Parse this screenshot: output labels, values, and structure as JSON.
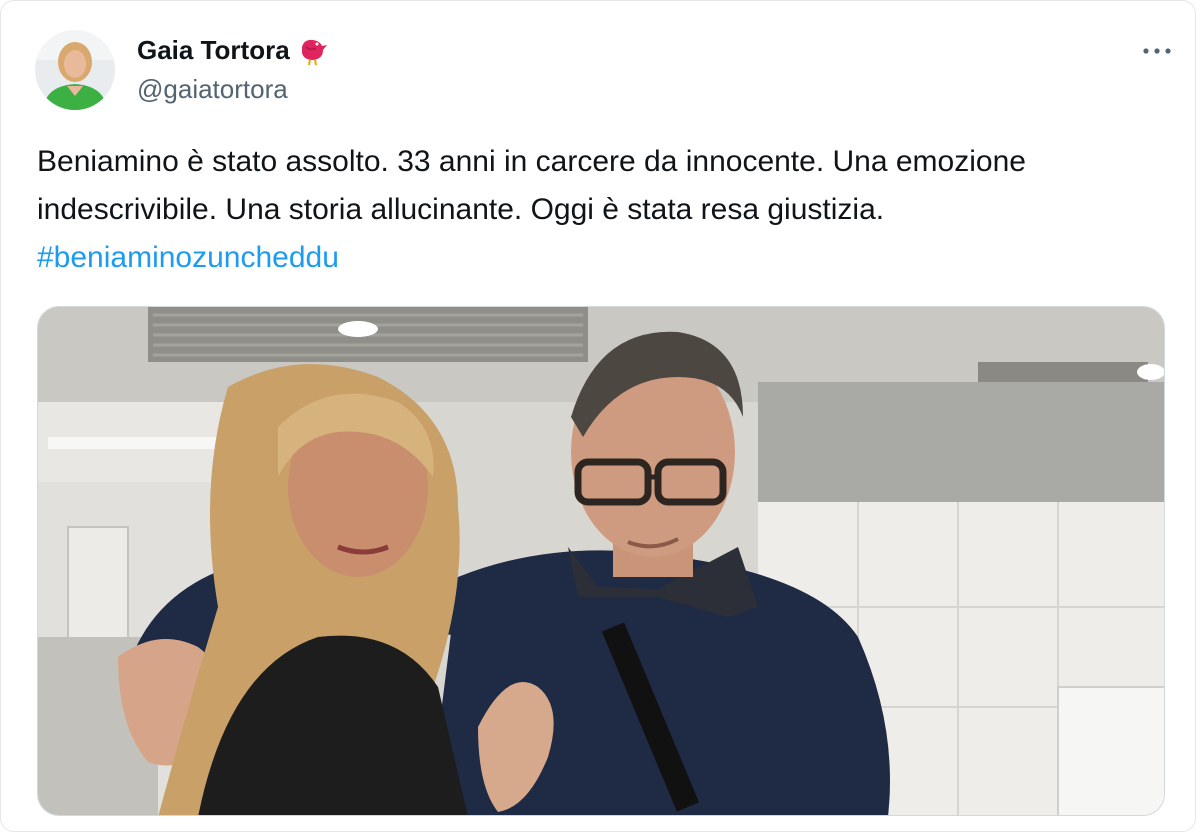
{
  "author": {
    "display_name": "Gaia Tortora",
    "handle": "@gaiatortora",
    "badge_icon": "red-bird-icon",
    "avatar_icon": "profile-photo"
  },
  "tweet": {
    "text_before_hashtag": "Beniamino è stato assolto. 33 anni in carcere da innocente. Una emozione indescrivibile. Una storia allucinante. Oggi è stata resa giustizia. ",
    "hashtag": "#beniaminozuncheddu"
  },
  "menu": {
    "more_icon": "more-options-icon"
  },
  "media": {
    "type": "photo",
    "icon": "photo-two-people"
  },
  "colors": {
    "link": "#1d9bf0",
    "secondary_text": "#536471",
    "badge": "#e0245e"
  }
}
